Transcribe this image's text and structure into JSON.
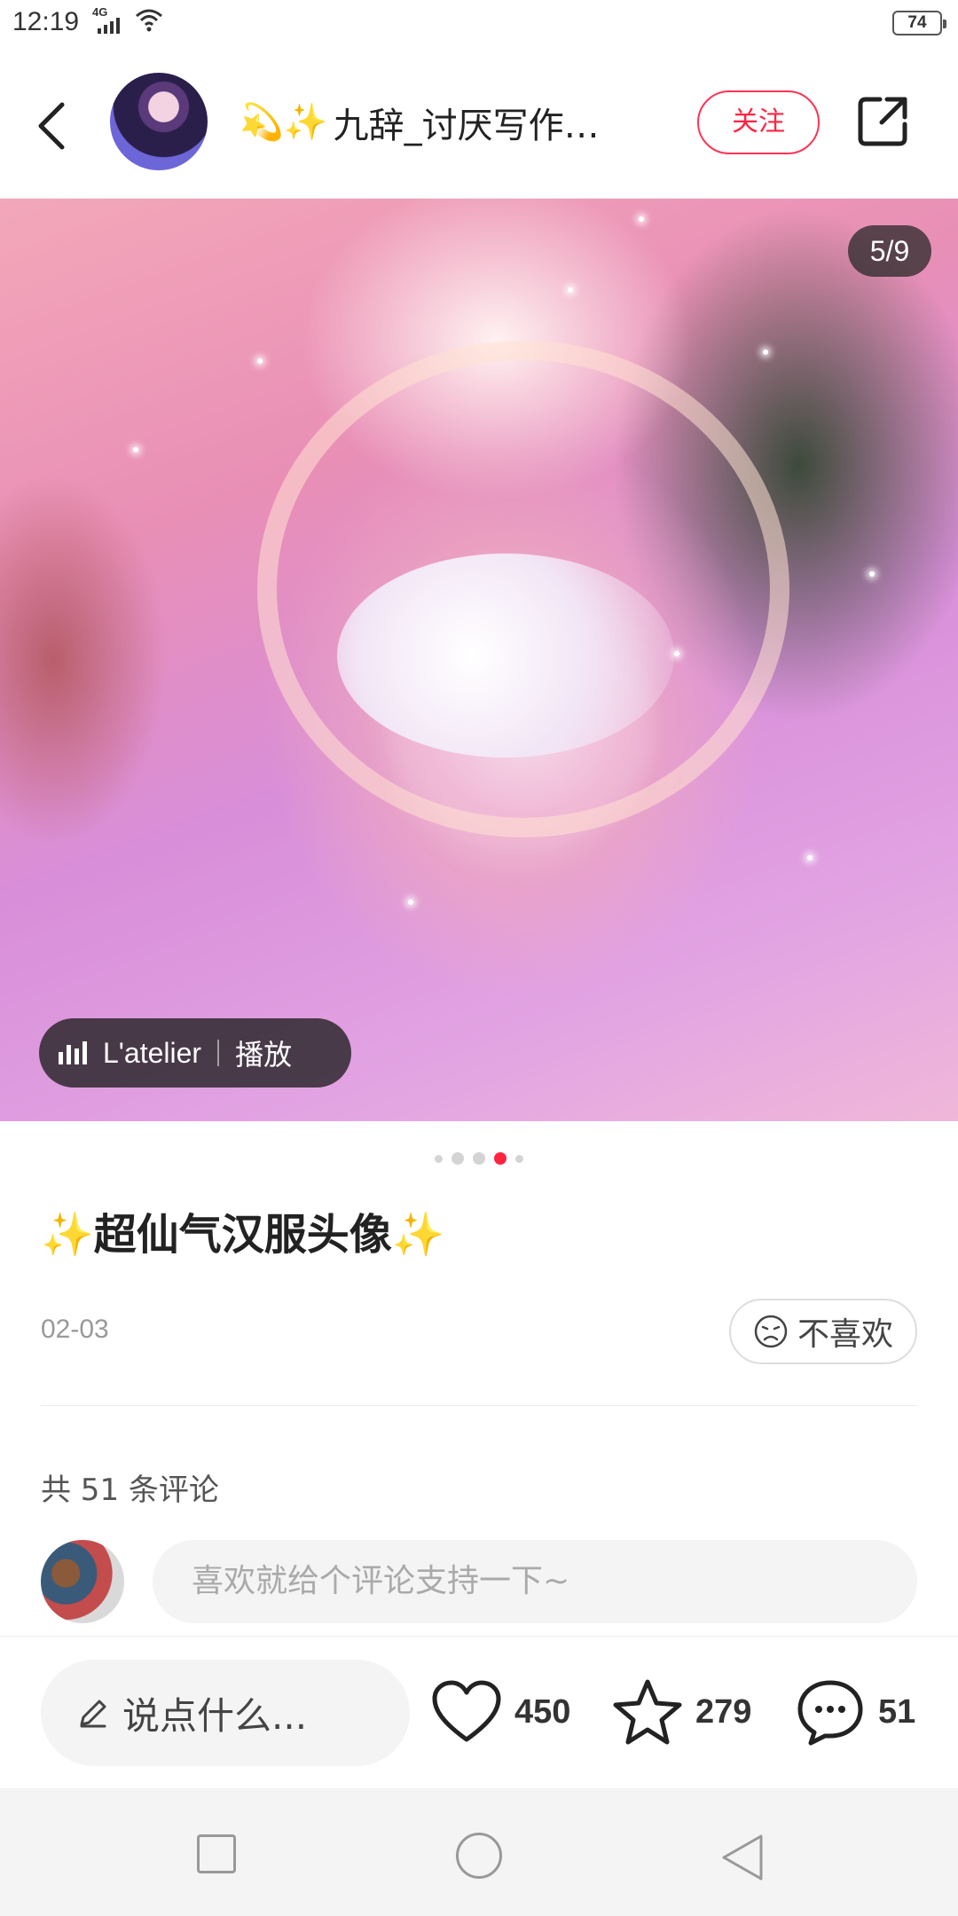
{
  "status_bar": {
    "time": "12:19",
    "network": "4G",
    "battery": "74"
  },
  "header": {
    "author_emoji": "💫✨",
    "author_name": "九辞_讨厌写作…",
    "follow_label": "关注",
    "icons": [
      "back-icon",
      "share-icon"
    ]
  },
  "post": {
    "image_counter": "5/9",
    "music_title": "L'atelier",
    "music_play_label": "播放",
    "pages_total": 5,
    "active_page": 4,
    "title": "✨超仙气汉服头像✨",
    "date": "02-03",
    "dislike_label": "不喜欢"
  },
  "comments": {
    "count_text": "共 51 条评论",
    "input_placeholder": "喜欢就给个评论支持一下~"
  },
  "action_bar": {
    "say_placeholder": "说点什么...",
    "likes": "450",
    "collects": "279",
    "comments": "51"
  },
  "colors": {
    "accent": "#ff2442",
    "muted_text": "#999999",
    "input_bg": "#f4f4f4"
  }
}
